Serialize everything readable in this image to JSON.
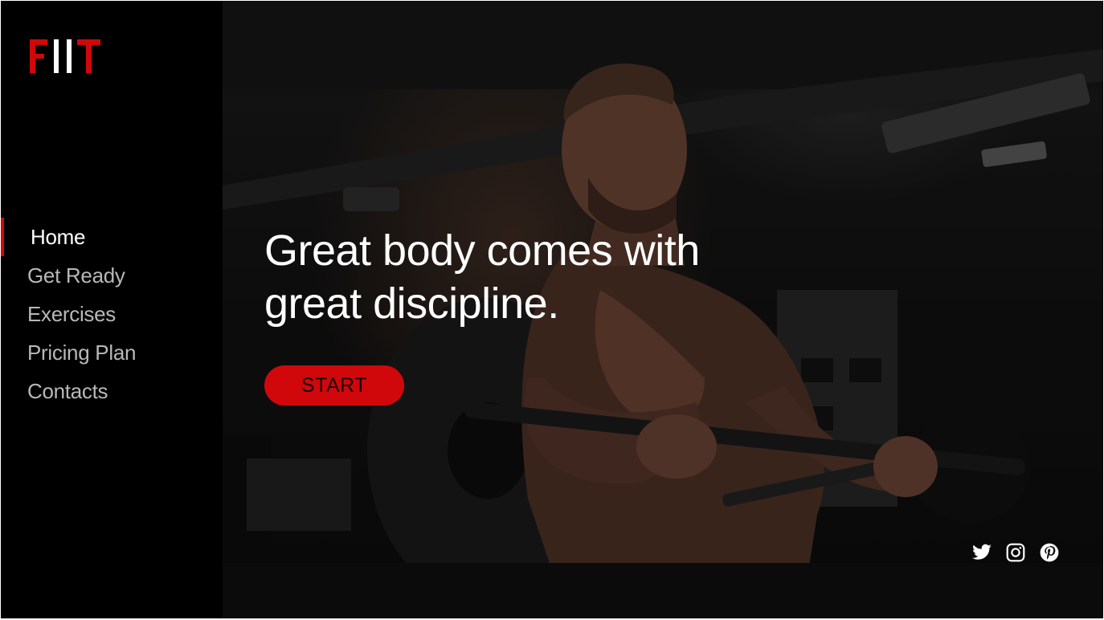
{
  "brand": {
    "logo_text": "FIIT",
    "accent_color": "#d0080b"
  },
  "nav": {
    "items": [
      {
        "label": "Home",
        "active": true
      },
      {
        "label": "Get Ready",
        "active": false
      },
      {
        "label": "Exercises",
        "active": false
      },
      {
        "label": "Pricing Plan",
        "active": false
      },
      {
        "label": "Contacts",
        "active": false
      }
    ]
  },
  "hero": {
    "headline_line1": "Great body comes with",
    "headline_line2": "great discipline.",
    "cta_label": "START",
    "background_image": "dark gym photo of man doing barbell curls"
  },
  "social": {
    "icons": [
      "twitter-icon",
      "instagram-icon",
      "pinterest-icon"
    ]
  }
}
